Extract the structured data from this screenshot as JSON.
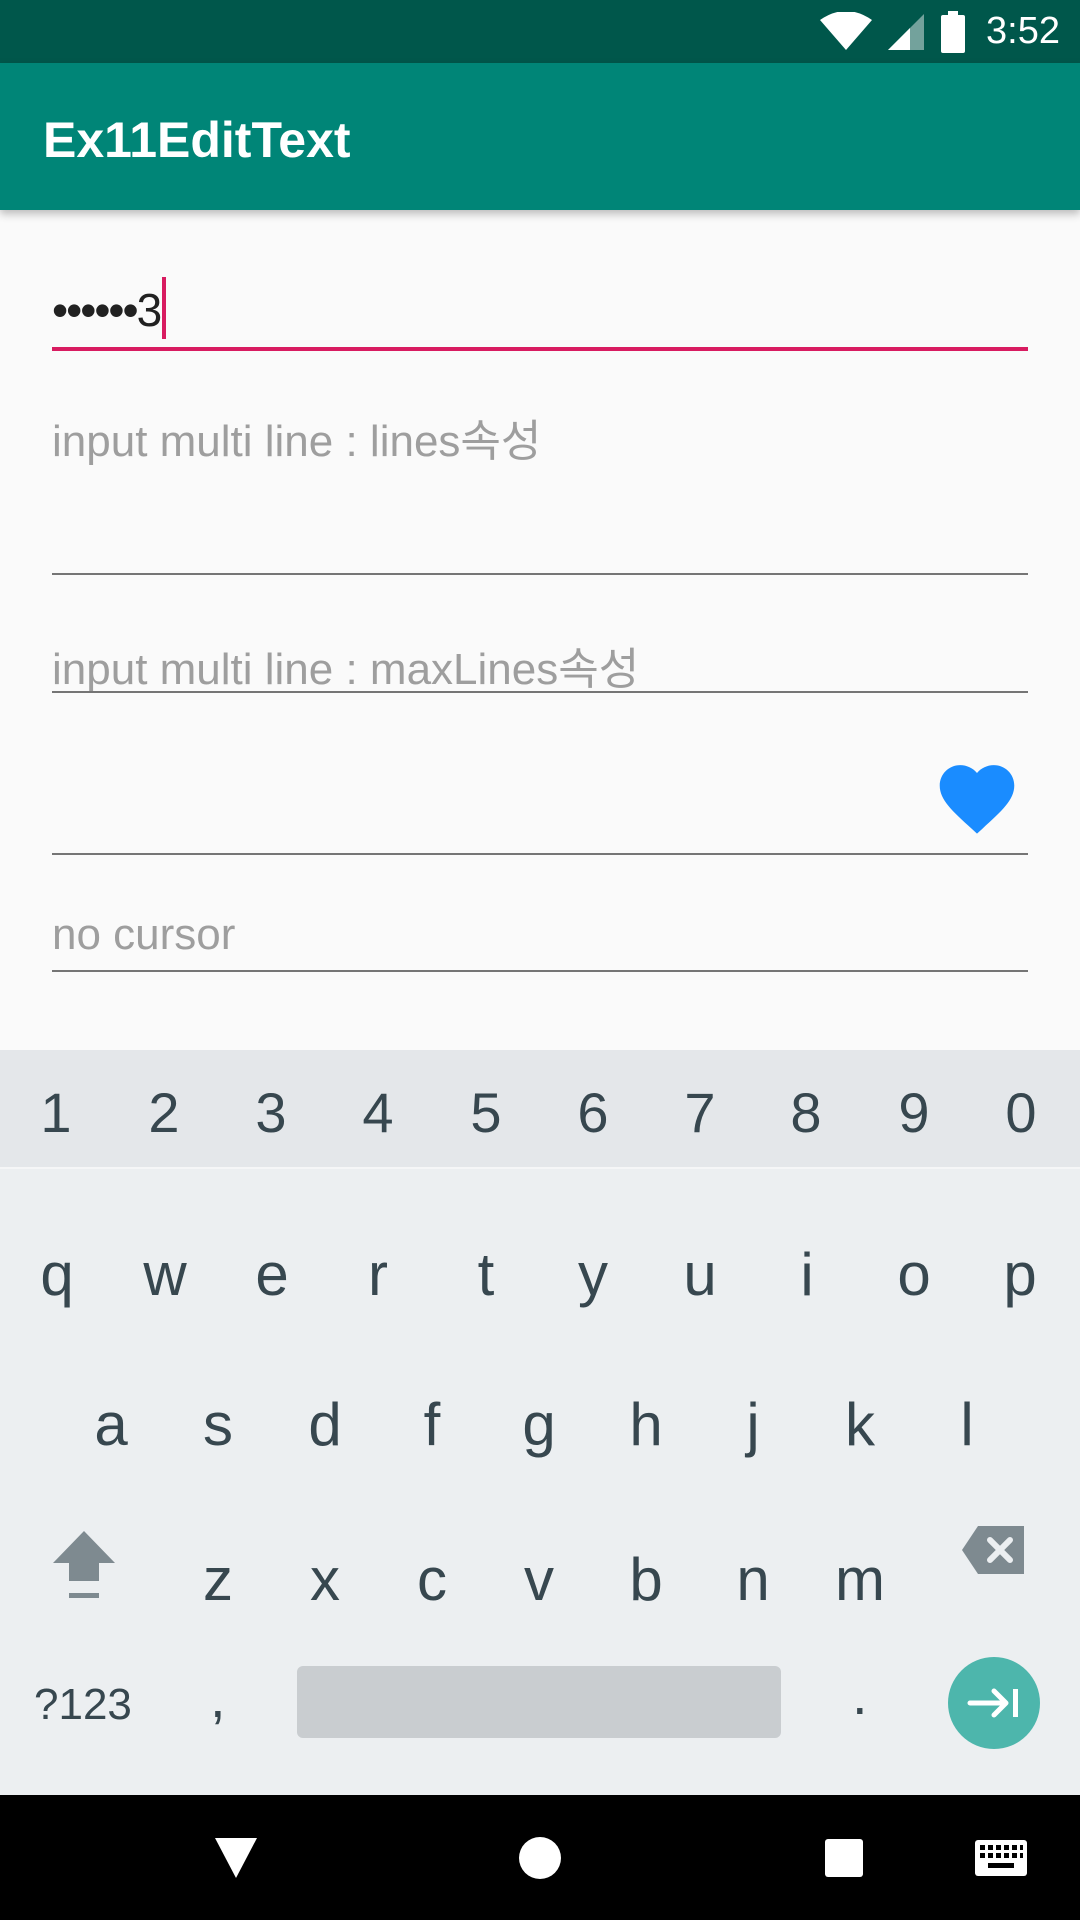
{
  "status_bar": {
    "time": "3:52",
    "icons": [
      "wifi-icon",
      "signal-icon",
      "battery-icon"
    ]
  },
  "app_bar": {
    "title": "Ex11EditText"
  },
  "fields": {
    "password": {
      "value": "••••••3"
    },
    "lines_field": {
      "placeholder": "input multi line : lines속성"
    },
    "maxlines_field": {
      "placeholder": "input multi line : maxLines속성"
    },
    "heart_field": {
      "icon": "heart-icon",
      "icon_color": "#1a8cff"
    },
    "no_cursor_field": {
      "placeholder": "no cursor"
    }
  },
  "keyboard": {
    "numbers": [
      "1",
      "2",
      "3",
      "4",
      "5",
      "6",
      "7",
      "8",
      "9",
      "0"
    ],
    "row1": [
      "q",
      "w",
      "e",
      "r",
      "t",
      "y",
      "u",
      "i",
      "o",
      "p"
    ],
    "row2": [
      "a",
      "s",
      "d",
      "f",
      "g",
      "h",
      "j",
      "k",
      "l"
    ],
    "row3": [
      "z",
      "x",
      "c",
      "v",
      "b",
      "n",
      "m"
    ],
    "symbols_label": "?123",
    "comma_label": ",",
    "period_label": ".",
    "enter_color": "#4db6ac"
  },
  "colors": {
    "status_bar": "#00574b",
    "app_bar": "#008577",
    "accent": "#d81b60"
  }
}
